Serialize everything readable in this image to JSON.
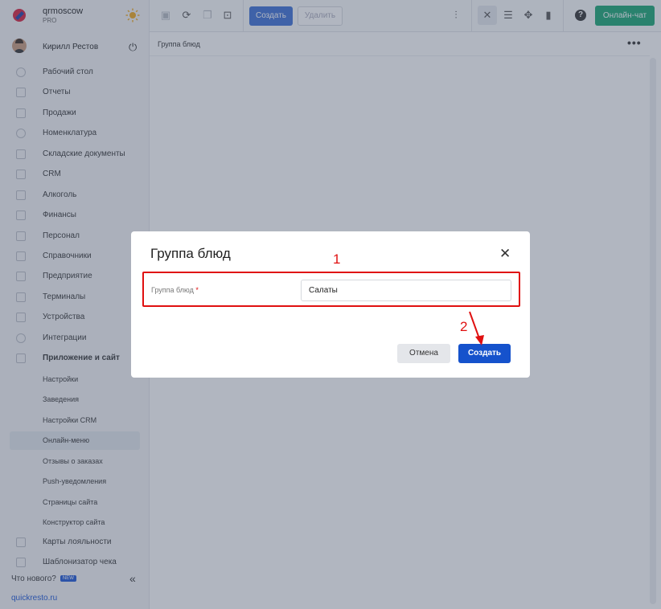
{
  "brand": {
    "org": "qrmoscow",
    "plan": "PRO"
  },
  "user": {
    "name": "Кирилл Рестов"
  },
  "sidebar": {
    "items": [
      {
        "label": "Рабочий стол",
        "icon": "dashboard-icon"
      },
      {
        "label": "Отчеты",
        "icon": "chart-icon"
      },
      {
        "label": "Продажи",
        "icon": "basket-icon"
      },
      {
        "label": "Номенклатура",
        "icon": "link-icon"
      },
      {
        "label": "Складские документы",
        "icon": "archive-icon"
      },
      {
        "label": "CRM",
        "icon": "people-icon"
      },
      {
        "label": "Алкоголь",
        "icon": "glass-icon"
      },
      {
        "label": "Финансы",
        "icon": "wallet-icon"
      },
      {
        "label": "Персонал",
        "icon": "staff-icon"
      },
      {
        "label": "Справочники",
        "icon": "book-icon"
      },
      {
        "label": "Предприятие",
        "icon": "building-icon"
      },
      {
        "label": "Терминалы",
        "icon": "terminal-icon"
      },
      {
        "label": "Устройства",
        "icon": "printer-icon"
      },
      {
        "label": "Интеграции",
        "icon": "integration-icon"
      },
      {
        "label": "Приложение и сайт",
        "icon": "app-icon"
      }
    ],
    "sub_items": [
      {
        "label": "Настройки"
      },
      {
        "label": "Заведения"
      },
      {
        "label": "Настройки CRM"
      },
      {
        "label": "Онлайн-меню",
        "active": true
      },
      {
        "label": "Отзывы о заказах"
      },
      {
        "label": "Push-уведомления"
      },
      {
        "label": "Страницы сайта"
      },
      {
        "label": "Конструктор сайта"
      }
    ],
    "bottom_items": [
      {
        "label": "Карты лояльности",
        "icon": "loyalty-card-icon"
      },
      {
        "label": "Шаблонизатор чека",
        "icon": "receipt-icon"
      }
    ],
    "whats_new": "Что нового?",
    "new_badge": "NEW",
    "footer_link": "quickresto.ru"
  },
  "toolbar": {
    "create_label": "Создать",
    "delete_label": "Удалить",
    "chat_label": "Онлайн-чат",
    "help_label": "?"
  },
  "content": {
    "breadcrumb": "Группа блюд",
    "more_label": "•••"
  },
  "modal": {
    "title": "Группа блюд",
    "close_label": "✕",
    "field_label": "Группа блюд",
    "required_mark": "*",
    "field_value": "Салаты",
    "cancel_label": "Отмена",
    "submit_label": "Создать"
  },
  "annotations": {
    "step1": "1",
    "step2": "2",
    "color": "#e01010"
  },
  "colors": {
    "primary": "#1552cc",
    "chat": "#17a673"
  }
}
